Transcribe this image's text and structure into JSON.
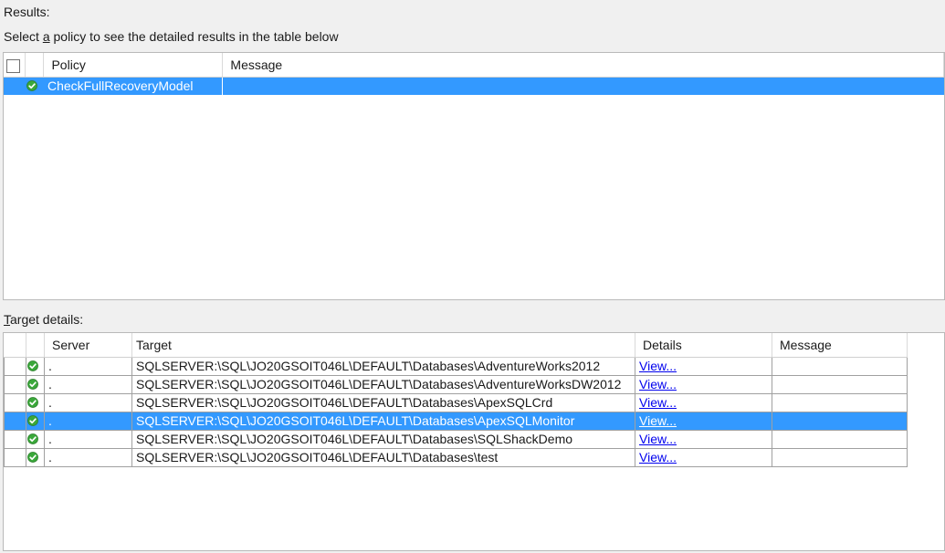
{
  "results_label": "Results:",
  "select_hint": {
    "before": "Select ",
    "mnemonic": "a",
    "after": " policy to see the detailed results in the table below"
  },
  "policy_grid": {
    "columns": [
      "",
      "Policy",
      "Message"
    ],
    "rows": [
      {
        "status": "success-icon",
        "policy": "CheckFullRecoveryModel",
        "message": "",
        "selected": true
      }
    ]
  },
  "target_label": {
    "mnemonic": "T",
    "after": "arget details:"
  },
  "target_grid": {
    "columns": [
      "",
      "Server",
      "Target",
      "Details",
      "Message"
    ],
    "rows": [
      {
        "status": "success-icon",
        "server": ".",
        "target": "SQLSERVER:\\SQL\\JO20GSOIT046L\\DEFAULT\\Databases\\AdventureWorks2012",
        "details": "View...",
        "message": "",
        "selected": false
      },
      {
        "status": "success-icon",
        "server": ".",
        "target": "SQLSERVER:\\SQL\\JO20GSOIT046L\\DEFAULT\\Databases\\AdventureWorksDW2012",
        "details": "View...",
        "message": "",
        "selected": false
      },
      {
        "status": "success-icon",
        "server": ".",
        "target": "SQLSERVER:\\SQL\\JO20GSOIT046L\\DEFAULT\\Databases\\ApexSQLCrd",
        "details": "View...",
        "message": "",
        "selected": false
      },
      {
        "status": "success-icon",
        "server": ".",
        "target": "SQLSERVER:\\SQL\\JO20GSOIT046L\\DEFAULT\\Databases\\ApexSQLMonitor",
        "details": "View...",
        "message": "",
        "selected": true
      },
      {
        "status": "success-icon",
        "server": ".",
        "target": "SQLSERVER:\\SQL\\JO20GSOIT046L\\DEFAULT\\Databases\\SQLShackDemo",
        "details": "View...",
        "message": "",
        "selected": false
      },
      {
        "status": "success-icon",
        "server": ".",
        "target": "SQLSERVER:\\SQL\\JO20GSOIT046L\\DEFAULT\\Databases\\test",
        "details": "View...",
        "message": "",
        "selected": false
      }
    ]
  },
  "colors": {
    "selection": "#3399ff",
    "link": "#0000ee",
    "success": "#3aa83a"
  }
}
